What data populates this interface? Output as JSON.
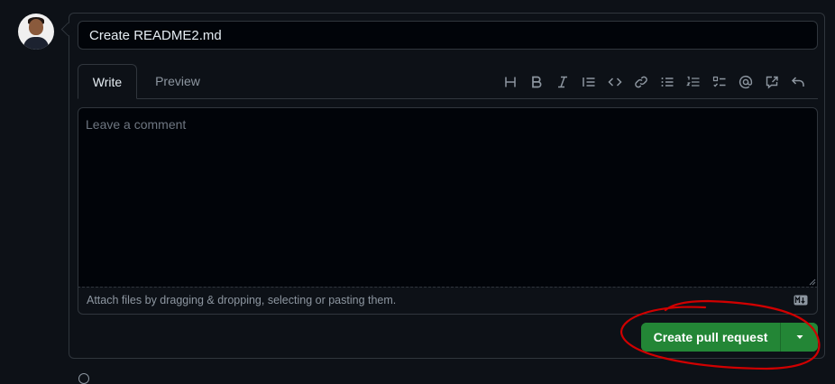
{
  "form": {
    "title_value": "Create README2.md",
    "tabs": [
      {
        "label": "Write"
      },
      {
        "label": "Preview"
      }
    ],
    "toolbar": [
      {
        "icon": "heading-icon"
      },
      {
        "icon": "bold-icon"
      },
      {
        "icon": "italic-icon"
      },
      {
        "icon": "quote-icon"
      },
      {
        "icon": "code-icon"
      },
      {
        "icon": "link-icon"
      },
      {
        "icon": "unordered-list-icon"
      },
      {
        "icon": "ordered-list-icon"
      },
      {
        "icon": "task-list-icon"
      },
      {
        "icon": "mention-icon"
      },
      {
        "icon": "reference-icon"
      },
      {
        "icon": "undo-icon"
      }
    ],
    "comment_placeholder": "Leave a comment",
    "comment_value": "",
    "attach_text": "Attach files by dragging & dropping, selecting or pasting them.",
    "markdown_icon": "markdown-icon"
  },
  "actions": {
    "create_label": "Create pull request",
    "dropdown_icon": "triangle-down-icon"
  },
  "colors": {
    "background": "#0d1117",
    "border": "#30363d",
    "primary_button": "#238636",
    "annotation": "#d00000"
  }
}
